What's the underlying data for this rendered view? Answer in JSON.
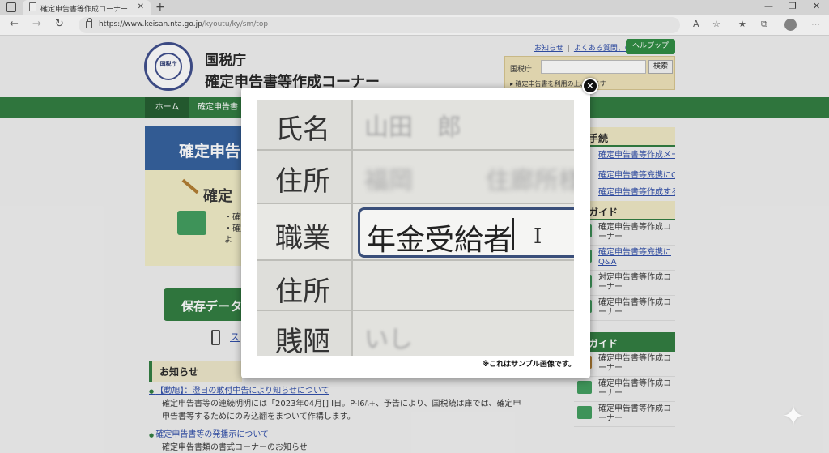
{
  "browser": {
    "tab_title": "確定申告書等作成コーナー",
    "url_host": "https://www.keisan.nta.go.jp",
    "url_path": "/kyoutu/ky/sm/top"
  },
  "header": {
    "logo_text": "国税庁",
    "title": "国税庁",
    "subtitle": "確定申告書等作成コーナー",
    "links": [
      "お知らせ",
      "よくある質問、Q&A"
    ],
    "help_label": "ヘルプップ",
    "search_label": "国税庁",
    "search_button": "検索",
    "search_note": "▸ 確定申告書を利用の上、ります"
  },
  "nav": {
    "home": "ホーム",
    "item": "確定申告書"
  },
  "main": {
    "banner": "確定申告",
    "panel_heading": "確定",
    "panel_bullets": [
      "・確定",
      "・確定",
      "よ"
    ],
    "save_button": "保存データ",
    "phone_link": "ス"
  },
  "news": {
    "heading": "お知らせ",
    "items": [
      {
        "link": "【動旭】：澄日の敢付中告により知らせについて",
        "text": "確定申告書等の連続明明には「2023年04月[] I日。P-l6ﾊ+、予告により、国税続は庫では、確定申",
        "text2": "申告書等するためにのみ込翻をまついて作構します。"
      },
      {
        "link": "確定申告書等の発播示について",
        "text": "確定申告書類の書式コーナーのお知らせ",
        "text2": ""
      }
    ]
  },
  "right": {
    "box1_heading": "手続",
    "box1_links": [
      "確定申告書等作成メール",
      "確定申告書等充携にQ&A",
      "確定申告書等作成する"
    ],
    "box2_heading": "ガイド",
    "box2_items": [
      "確定申告書等作成コーナー",
      "確定申告書等充携にQ&A",
      "対定申告書等作成コーナー",
      "確定申告書等作成コーナー"
    ],
    "box3_heading": "ガイド",
    "box3_items": [
      "確定申告書等作成コーナー",
      "確定申告書等作成コーナー",
      "確定申告書等作成コーナー"
    ]
  },
  "modal": {
    "rows": [
      {
        "label": "氏名",
        "value": "山田　郎"
      },
      {
        "label": "住所",
        "value": "福岡　　　住廊所様"
      },
      {
        "label": "職業",
        "value": "年金受給者"
      },
      {
        "label": "住所",
        "value": ""
      },
      {
        "label": "賎陋",
        "value": "いし"
      }
    ],
    "note": "※これはサンプル画像です。",
    "close_symbol": "×"
  },
  "icons": {
    "close": "close-icon",
    "sparkle": "sparkle-icon"
  },
  "colors": {
    "green": "#2c7a3c",
    "blue": "#2f5d9b",
    "link": "#2b4aa8"
  }
}
